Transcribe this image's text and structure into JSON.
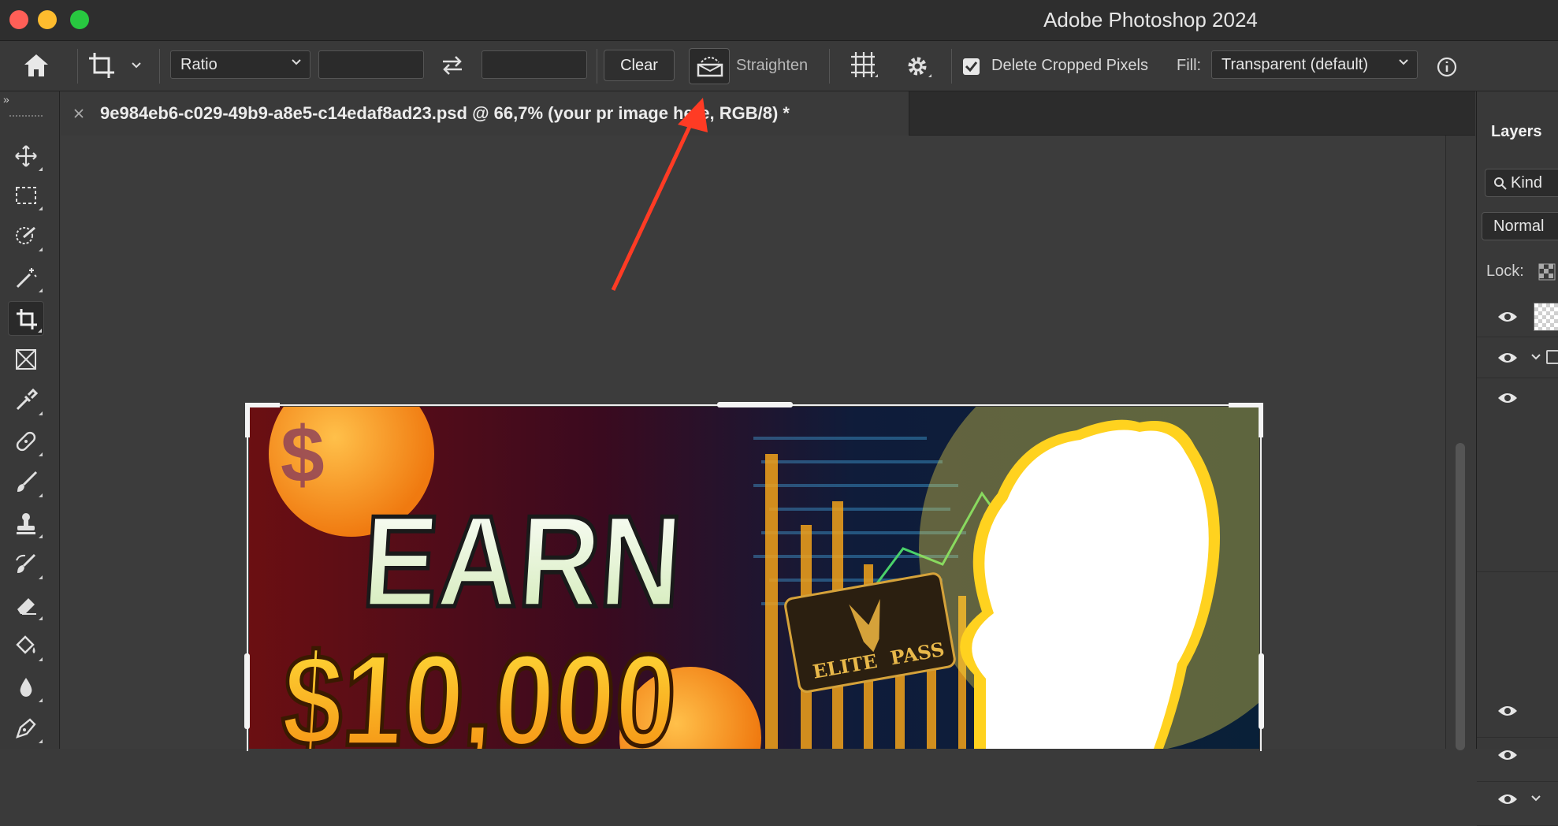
{
  "window": {
    "title": "Adobe Photoshop 2024"
  },
  "options_bar": {
    "ratio_label": "Ratio",
    "width_value": "",
    "height_value": "",
    "clear_label": "Clear",
    "straighten_label": "Straighten",
    "delete_cropped_label": "Delete Cropped Pixels",
    "delete_cropped_checked": true,
    "fill_label": "Fill:",
    "fill_value": "Transparent (default)"
  },
  "document": {
    "tab_title": "9e984eb6-c029-49b9-a8e5-c14edaf8ad23.psd @ 66,7% (your pr  image here, RGB/8) *",
    "zoom": "66,7%"
  },
  "artwork": {
    "headline_1": "EARN",
    "headline_2": "$10,000",
    "card_text_1": "ELITE",
    "card_text_2": "PASS",
    "coin_symbol": "$"
  },
  "layers_panel": {
    "title": "Layers",
    "filter_label": "Kind",
    "blend_mode": "Normal",
    "lock_label": "Lock:"
  },
  "colors": {
    "accent_arrow": "#ff3b24",
    "traffic_close": "#ff5f57",
    "traffic_min": "#febc2e",
    "traffic_max": "#28c840"
  },
  "icons": [
    "home-icon",
    "crop-icon",
    "swap-icon",
    "straighten-icon",
    "grid-overlay-icon",
    "gear-icon",
    "info-icon",
    "move-icon",
    "marquee-icon",
    "quick-select-icon",
    "magic-wand-icon",
    "frame-icon",
    "eyedropper-icon",
    "healing-icon",
    "brush-icon",
    "stamp-icon",
    "history-brush-icon",
    "eraser-icon",
    "bucket-icon",
    "blur-icon",
    "pen-icon",
    "eye-icon",
    "search-icon",
    "checker-lock-icon"
  ]
}
